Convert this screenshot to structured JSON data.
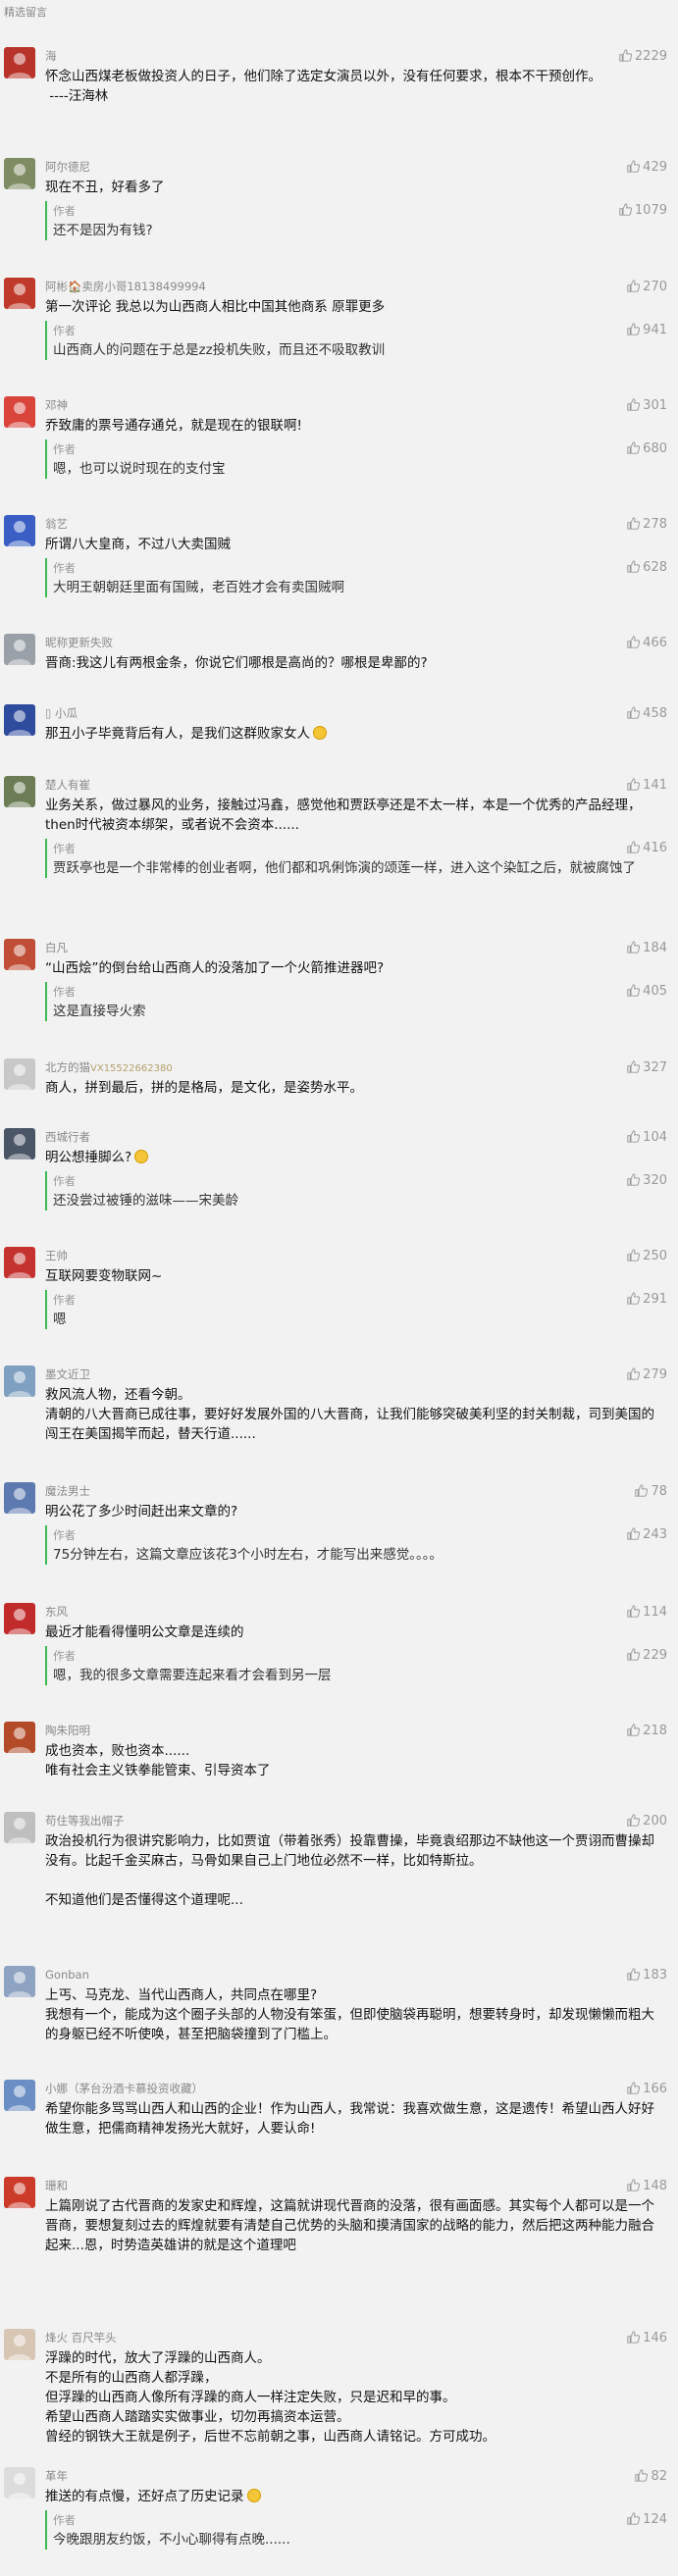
{
  "header": {
    "title": "精选留言"
  },
  "comments": [
    {
      "name": "海",
      "likes": "2229",
      "text": "怀念山西煤老板做投资人的日子，他们除了选定女演员以外，没有任何要求，根本不干预创作。\n ----汪海林"
    },
    {
      "name": "阿尔德尼",
      "likes": "429",
      "text": "现在不丑，好看多了",
      "reply": {
        "label": "作者",
        "likes": "1079",
        "text": "还不是因为有钱?"
      }
    },
    {
      "name": "阿彬🏠卖房小哥18138499994",
      "likes": "270",
      "text": "第一次评论 我总以为山西商人相比中国其他商系 原罪更多",
      "reply": {
        "label": "作者",
        "likes": "941",
        "text": "山西商人的问题在于总是zz投机失败，而且还不吸取教训"
      }
    },
    {
      "name": "邓神",
      "likes": "301",
      "text": "乔致庸的票号通存通兑，就是现在的银联啊!",
      "reply": {
        "label": "作者",
        "likes": "680",
        "text": "嗯，也可以说时现在的支付宝"
      }
    },
    {
      "name": "翁艺",
      "likes": "278",
      "text": "所谓八大皇商，不过八大卖国贼",
      "reply": {
        "label": "作者",
        "likes": "628",
        "text": "大明王朝朝廷里面有国贼，老百姓才会有卖国贼啊"
      }
    },
    {
      "name": "昵称更新失败",
      "likes": "466",
      "text": "晋商:我这儿有两根金条，你说它们哪根是高尚的？哪根是卑鄙的?"
    },
    {
      "name": "▯ 小瓜",
      "likes": "458",
      "text": "那丑小子毕竟背后有人，是我们这群败家女人",
      "emoji": true
    },
    {
      "name": "楚人有崔",
      "likes": "141",
      "text": "业务关系，做过暴风的业务，接触过冯鑫，感觉他和贾跃亭还是不太一样，本是一个优秀的产品经理，then时代被资本绑架，或者说不会资本......",
      "reply": {
        "label": "作者",
        "likes": "416",
        "text": "贾跃亭也是一个非常棒的创业者啊，他们都和巩俐饰演的颂莲一样，进入这个染缸之后，就被腐蚀了"
      }
    },
    {
      "name": "白凡",
      "likes": "184",
      "text": "“山西烩”的倒台给山西商人的没落加了一个火箭推进器吧?",
      "reply": {
        "label": "作者",
        "likes": "405",
        "text": "这是直接导火索"
      }
    },
    {
      "name": "北方的猫",
      "sub": "VX15522662380",
      "likes": "327",
      "text": "商人，拼到最后，拼的是格局，是文化，是姿势水平。"
    },
    {
      "name": "西城行者",
      "likes": "104",
      "text": "明公想捶脚么?",
      "emoji": true,
      "reply": {
        "label": "作者",
        "likes": "320",
        "text": "还没尝过被锤的滋味——宋美龄"
      }
    },
    {
      "name": "王帅",
      "likes": "250",
      "text": "互联网要变物联网~",
      "reply": {
        "label": "作者",
        "likes": "291",
        "text": "嗯"
      }
    },
    {
      "name": "墨文近卫",
      "likes": "279",
      "text": "救风流人物，还看今朝。\n清朝的八大晋商已成往事，要好好发展外国的八大晋商，让我们能够突破美利坚的封关制裁，司到美国的闯王在美国揭竿而起，替天行道......"
    },
    {
      "name": "魔法男士",
      "likes": "78",
      "text": "明公花了多少时间赶出来文章的?",
      "reply": {
        "label": "作者",
        "likes": "243",
        "text": "75分钟左右，这篇文章应该花3个小时左右，才能写出来感觉。。。。"
      }
    },
    {
      "name": "东风",
      "likes": "114",
      "text": "最近才能看得懂明公文章是连续的",
      "reply": {
        "label": "作者",
        "likes": "229",
        "text": "嗯，我的很多文章需要连起来看才会看到另一层"
      }
    },
    {
      "name": "陶朱阳明",
      "likes": "218",
      "text": "成也资本，败也资本......\n唯有社会主义铁拳能管束、引导资本了"
    },
    {
      "name": "苟住等我出帽子",
      "likes": "200",
      "text": "政治投机行为很讲究影响力，比如贾谊（带着张秀）投靠曹操，毕竟袁绍那边不缺他这一个贾诩而曹操却没有。比起千金买麻古，马骨如果自己上门地位必然不一样，比如特斯拉。\n\n不知道他们是否懂得这个道理呢..."
    },
    {
      "name": "Gonban",
      "likes": "183",
      "text": "上丐、马克龙、当代山西商人，共同点在哪里?\n我想有一个，能成为这个圈子头部的人物没有笨蛋，但即使脑袋再聪明，想要转身时，却发现懒懒而粗大的身躯已经不听使唤，甚至把脑袋撞到了门槛上。"
    },
    {
      "name": "小娜（茅台汾酒卡慕投资收藏）",
      "likes": "166",
      "text": "希望你能多骂骂山西人和山西的企业！作为山西人，我常说：我喜欢做生意，这是遗传！希望山西人好好做生意，把儒商精神发扬光大就好，人要认命!"
    },
    {
      "name": "珊和",
      "likes": "148",
      "text": "上篇刚说了古代晋商的发家史和辉煌，这篇就讲现代晋商的没落，很有画面感。其实每个人都可以是一个晋商，要想复刻过去的辉煌就要有清楚自己优势的头脑和摸清国家的战略的能力，然后把这两种能力融合起来...恩，时势造英雄讲的就是这个道理吧"
    },
    {
      "name": "烽火 百尺竿头",
      "likes": "146",
      "text": "浮躁的时代，放大了浮躁的山西商人。\n不是所有的山西商人都浮躁，\n但浮躁的山西商人像所有浮躁的商人一样注定失败，只是迟和早的事。\n希望山西商人踏踏实实做事业，切勿再搞资本运营。\n曾经的钢铁大王就是例子，后世不忘前朝之事，山西商人请铭记。方可成功。"
    },
    {
      "name": "革年",
      "likes": "82",
      "text": "推送的有点慢，还好点了历史记录",
      "emoji": true,
      "reply": {
        "label": "作者",
        "likes": "124",
        "text": "今晚跟朋友约饭，不小心聊得有点晚......"
      }
    }
  ],
  "avatars": [
    "#b8342a",
    "#7f8b62",
    "#c03a2b",
    "#d9443b",
    "#3a5ec4",
    "#9aa0a8",
    "#2f4b9e",
    "#6c7c55",
    "#c04e36",
    "#c8c8c8",
    "#4a5566",
    "#c43330",
    "#7fa0c0",
    "#5c79b0",
    "#c02a2a",
    "#b34a28",
    "#bfbfbf",
    "#8ea3c2",
    "#6b8fc4",
    "#cc3b2a",
    "#d8c6b4",
    "#dcdcdc"
  ]
}
